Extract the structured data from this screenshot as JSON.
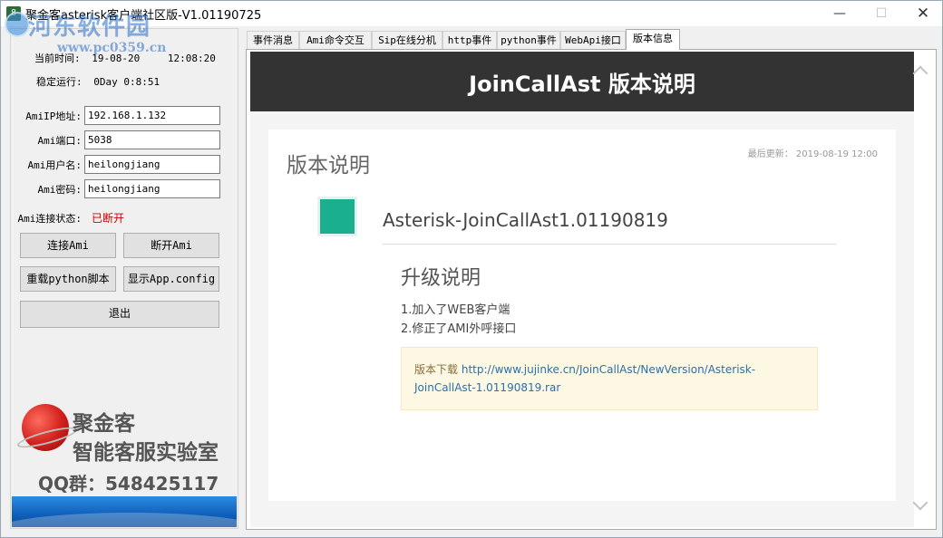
{
  "window": {
    "title": "聚金客asterisk客户端社区版-V1.01190725",
    "watermark": "河东软件园",
    "watermark_url": "www.pc0359.cn",
    "controls": {
      "minimize": "—",
      "maximize": "☐",
      "close": "✕"
    }
  },
  "left": {
    "current_time_label": "当前时间:",
    "current_date": "19-08-20",
    "current_time": "12:08:20",
    "uptime_label": "稳定运行:",
    "uptime_value": "0Day 0:8:51",
    "fields": [
      {
        "label": "AmiIP地址:",
        "value": "192.168.1.132"
      },
      {
        "label": "Ami端口:",
        "value": "5038"
      },
      {
        "label": "Ami用户名:",
        "value": "heilongjiang"
      },
      {
        "label": "Ami密码:",
        "value": "heilongjiang"
      }
    ],
    "status_label": "Ami连接状态:",
    "status_value": "已断开",
    "buttons": {
      "connect": "连接Ami",
      "disconnect": "断开Ami",
      "reload": "重载python脚本",
      "show_config": "显示App.config",
      "exit": "退出"
    },
    "brand_line1": "聚金客",
    "brand_line2": "智能客服实验室",
    "qq": "QQ群：548425117"
  },
  "tabs": [
    "事件消息",
    "Ami命令交互",
    "Sip在线分机",
    "http事件",
    "python事件",
    "WebApi接口",
    "版本信息"
  ],
  "active_tab": 6,
  "doc": {
    "hero_title": "JoinCallAst 版本说明",
    "card_title": "版本说明",
    "updated": "最后更新： 2019-08-19 12:00",
    "version": "Asterisk-JoinCallAst1.01190819",
    "upgrade_heading": "升级说明",
    "notes": [
      "1.加入了WEB客户端",
      "2.修正了AMI外呼接口"
    ],
    "download_label": "版本下载",
    "download_url": "http://www.jujinke.cn/JoinCallAst/NewVersion/Asterisk-JoinCallAst-1.01190819.rar"
  },
  "colors": {
    "hero_bg": "#333333",
    "accent_green": "#1aaf8e",
    "status_red": "#cc0000",
    "link": "#2a6fb0"
  }
}
